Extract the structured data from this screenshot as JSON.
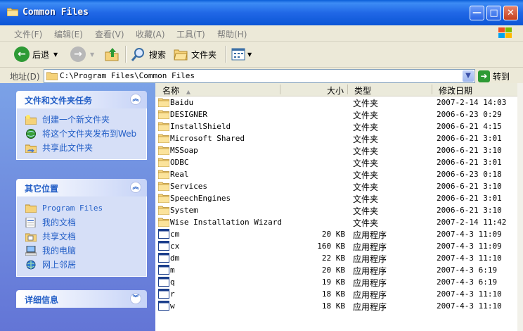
{
  "window": {
    "title": "Common Files",
    "minimize_glyph": "—",
    "maximize_glyph": "□",
    "close_glyph": "✕"
  },
  "menu": {
    "items": [
      "文件(F)",
      "编辑(E)",
      "查看(V)",
      "收藏(A)",
      "工具(T)",
      "帮助(H)"
    ]
  },
  "toolbar": {
    "back_label": "后退",
    "search_label": "搜索",
    "folders_label": "文件夹"
  },
  "address": {
    "label": "地址(D)",
    "path": "C:\\Program Files\\Common Files",
    "go_label": "转到"
  },
  "sidebar": {
    "tasks": {
      "title": "文件和文件夹任务",
      "items": [
        {
          "label": "创建一个新文件夹",
          "icon": "new-folder-icon"
        },
        {
          "label": "将这个文件夹发布到Web",
          "icon": "publish-web-icon"
        },
        {
          "label": "共享此文件夹",
          "icon": "share-folder-icon"
        }
      ]
    },
    "places": {
      "title": "其它位置",
      "items": [
        {
          "label": "Program Files",
          "icon": "folder-icon"
        },
        {
          "label": "我的文档",
          "icon": "my-documents-icon"
        },
        {
          "label": "共享文档",
          "icon": "shared-documents-icon"
        },
        {
          "label": "我的电脑",
          "icon": "my-computer-icon"
        },
        {
          "label": "网上邻居",
          "icon": "network-places-icon"
        }
      ]
    },
    "details": {
      "title": "详细信息"
    }
  },
  "list": {
    "columns": {
      "name": "名称",
      "size": "大小",
      "type": "类型",
      "modified": "修改日期"
    },
    "rows": [
      {
        "name": "Baidu",
        "size": "",
        "type": "文件夹",
        "date": "2007-2-14 14:03",
        "kind": "folder"
      },
      {
        "name": "DESIGNER",
        "size": "",
        "type": "文件夹",
        "date": "2006-6-23 0:29",
        "kind": "folder"
      },
      {
        "name": "InstallShield",
        "size": "",
        "type": "文件夹",
        "date": "2006-6-21 4:15",
        "kind": "folder"
      },
      {
        "name": "Microsoft Shared",
        "size": "",
        "type": "文件夹",
        "date": "2006-6-21 3:01",
        "kind": "folder"
      },
      {
        "name": "MSSoap",
        "size": "",
        "type": "文件夹",
        "date": "2006-6-21 3:10",
        "kind": "folder"
      },
      {
        "name": "ODBC",
        "size": "",
        "type": "文件夹",
        "date": "2006-6-21 3:01",
        "kind": "folder"
      },
      {
        "name": "Real",
        "size": "",
        "type": "文件夹",
        "date": "2006-6-23 0:18",
        "kind": "folder"
      },
      {
        "name": "Services",
        "size": "",
        "type": "文件夹",
        "date": "2006-6-21 3:10",
        "kind": "folder"
      },
      {
        "name": "SpeechEngines",
        "size": "",
        "type": "文件夹",
        "date": "2006-6-21 3:01",
        "kind": "folder"
      },
      {
        "name": "System",
        "size": "",
        "type": "文件夹",
        "date": "2006-6-21 3:10",
        "kind": "folder"
      },
      {
        "name": "Wise Installation Wizard",
        "size": "",
        "type": "文件夹",
        "date": "2007-2-14 11:42",
        "kind": "folder"
      },
      {
        "name": "cm",
        "size": "20 KB",
        "type": "应用程序",
        "date": "2007-4-3 11:09",
        "kind": "app"
      },
      {
        "name": "cx",
        "size": "160 KB",
        "type": "应用程序",
        "date": "2007-4-3 11:09",
        "kind": "app"
      },
      {
        "name": "dm",
        "size": "22 KB",
        "type": "应用程序",
        "date": "2007-4-3 11:10",
        "kind": "app"
      },
      {
        "name": "m",
        "size": "20 KB",
        "type": "应用程序",
        "date": "2007-4-3 6:19",
        "kind": "app"
      },
      {
        "name": "q",
        "size": "19 KB",
        "type": "应用程序",
        "date": "2007-4-3 6:19",
        "kind": "app"
      },
      {
        "name": "r",
        "size": "18 KB",
        "type": "应用程序",
        "date": "2007-4-3 11:10",
        "kind": "app"
      },
      {
        "name": "w",
        "size": "18 KB",
        "type": "应用程序",
        "date": "2007-4-3 11:10",
        "kind": "app"
      }
    ]
  },
  "colors": {
    "title_bar": "#0B55D6",
    "task_link": "#215dc6",
    "side_pane": "#6f8fe0",
    "menu_bg": "#ECE9D8"
  }
}
